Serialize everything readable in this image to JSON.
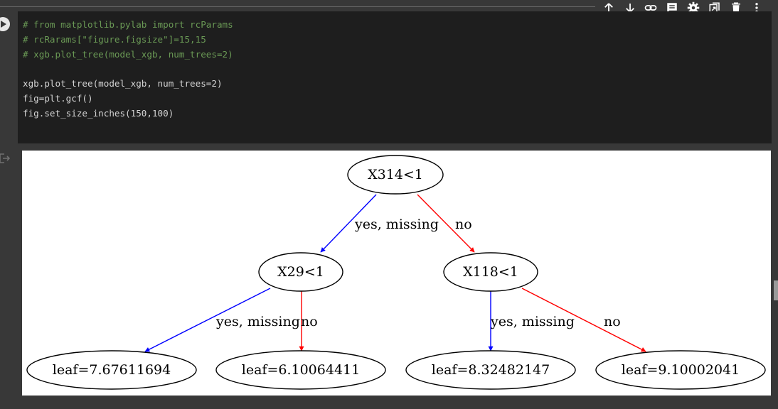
{
  "toolbar": {
    "icons": [
      "move-up-icon",
      "move-down-icon",
      "link-icon",
      "comment-icon",
      "settings-icon",
      "mirror-cell-icon",
      "delete-icon",
      "more-icon"
    ]
  },
  "code": {
    "lines": [
      "# from matplotlib.pylab import rcParams",
      "# rcRarams[\"figure.figsize\"]=15,15",
      "# xgb.plot_tree(model_xgb, num_trees=2)",
      "",
      "xgb.plot_tree(model_xgb, num_trees=2)",
      "fig=plt.gcf()",
      "fig.set_size_inches(150,100)"
    ]
  },
  "tree": {
    "root": "X314<1",
    "left": "X29<1",
    "right": "X118<1",
    "leaves": [
      "leaf=7.67611694",
      "leaf=6.10064411",
      "leaf=8.32482147",
      "leaf=9.10002041"
    ],
    "edge_labels": {
      "root_yes": "yes, missing",
      "root_no": "no",
      "left_yes": "yes, missing",
      "left_no": "no",
      "right_yes": "yes, missing",
      "right_no": "no"
    },
    "colors": {
      "yes": "#0000ff",
      "no": "#ff0000"
    }
  }
}
